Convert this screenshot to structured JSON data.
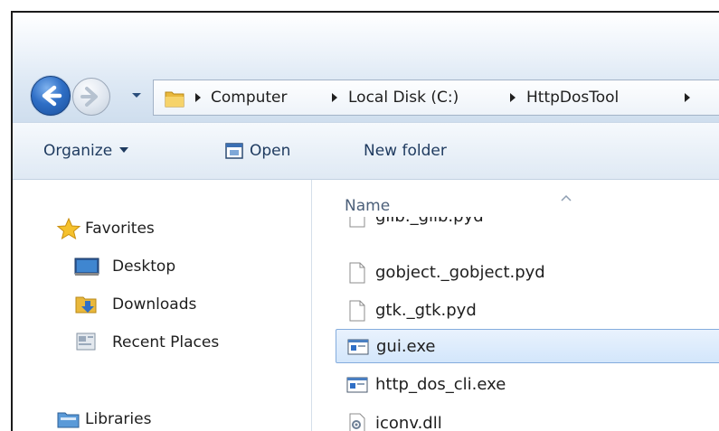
{
  "address": {
    "crumbs": [
      "Computer",
      "Local Disk (C:)",
      "HttpDosTool"
    ]
  },
  "toolbar": {
    "organize_label": "Organize",
    "open_label": "Open",
    "new_folder_label": "New folder"
  },
  "nav": {
    "favorites_label": "Favorites",
    "desktop_label": "Desktop",
    "downloads_label": "Downloads",
    "recent_label": "Recent Places",
    "libraries_label": "Libraries"
  },
  "files": {
    "column_name": "Name",
    "items": [
      {
        "name": "glib._glib.pyd",
        "icon": "blank-file-icon"
      },
      {
        "name": "gobject._gobject.pyd",
        "icon": "blank-file-icon"
      },
      {
        "name": "gtk._gtk.pyd",
        "icon": "blank-file-icon"
      },
      {
        "name": "gui.exe",
        "icon": "exe-icon",
        "selected": true
      },
      {
        "name": "http_dos_cli.exe",
        "icon": "exe-icon"
      },
      {
        "name": "iconv.dll",
        "icon": "dll-icon"
      }
    ]
  },
  "colors": {
    "selection_fill": "#d3e6fb",
    "selection_border": "#84acdd",
    "toolbar_text": "#1e3a5f"
  }
}
